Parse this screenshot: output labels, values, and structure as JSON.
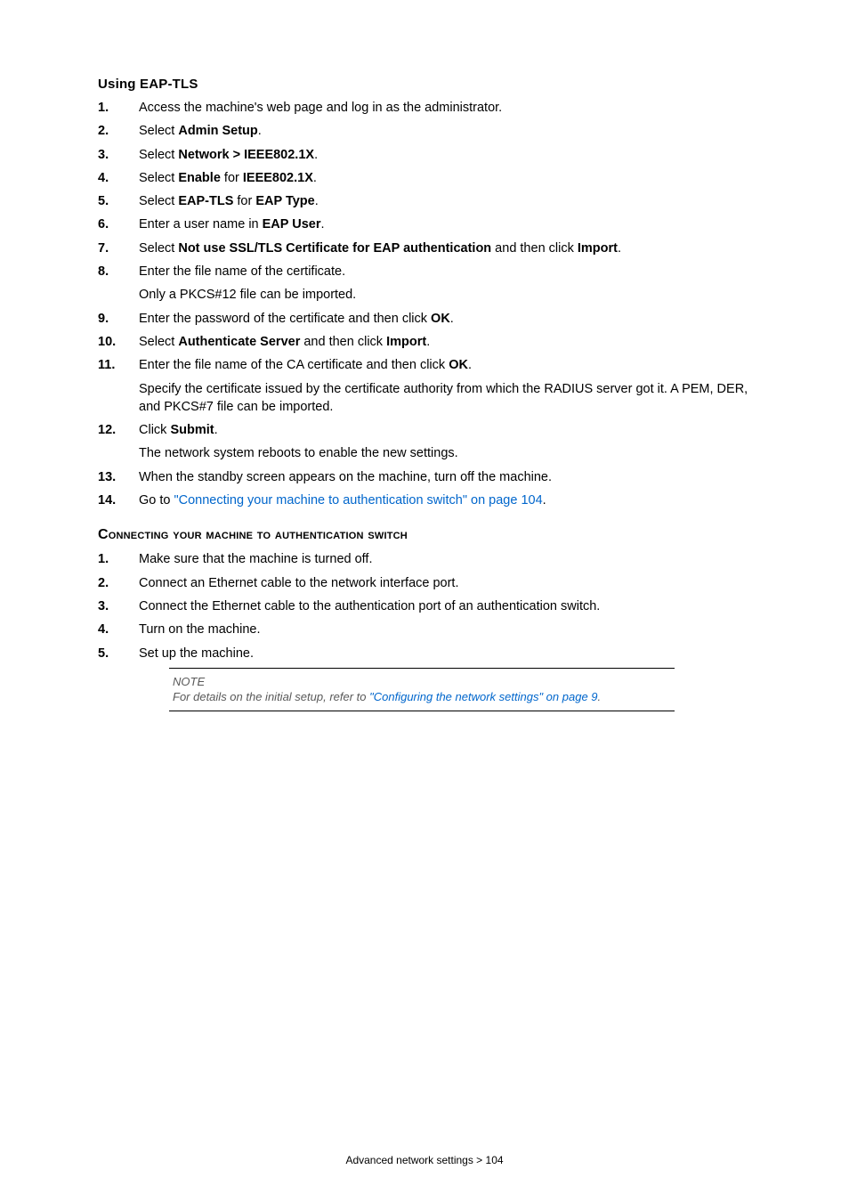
{
  "h1": "Using EAP-TLS",
  "steps1": [
    {
      "n": "1.",
      "html": "Access the machine's web page and log in as the administrator."
    },
    {
      "n": "2.",
      "html": "Select <b>Admin Setup</b>."
    },
    {
      "n": "3.",
      "html": "Select <b>Network > IEEE802.1X</b>."
    },
    {
      "n": "4.",
      "html": "Select <b>Enable</b> for <b>IEEE802.1X</b>."
    },
    {
      "n": "5.",
      "html": "Select <b>EAP-TLS</b> for <b>EAP Type</b>."
    },
    {
      "n": "6.",
      "html": "Enter a user name in <b>EAP User</b>."
    },
    {
      "n": "7.",
      "html": "Select <b>Not use SSL/TLS Certificate for EAP authentication</b> and then click <b>Import</b>."
    },
    {
      "n": "8.",
      "html": "Enter the file name of the certificate."
    }
  ],
  "indent8": "Only a PKCS#12 file can be imported.",
  "steps1b": [
    {
      "n": "9.",
      "html": "Enter the password of the certificate and then click <b>OK</b>."
    },
    {
      "n": "10.",
      "html": "Select <b>Authenticate Server</b> and then click <b>Import</b>."
    },
    {
      "n": "11.",
      "html": "Enter the file name of the CA certificate and then click <b>OK</b>."
    }
  ],
  "indent11": "Specify the certificate issued by the certificate authority from which the RADIUS server got it. A PEM, DER, and PKCS#7 file can be imported.",
  "steps1c": [
    {
      "n": "12.",
      "html": "Click <b>Submit</b>."
    }
  ],
  "indent12": "The network system reboots to enable the new settings.",
  "steps1d": [
    {
      "n": "13.",
      "html": "When the standby screen appears on the machine, turn off the machine."
    },
    {
      "n": "14.",
      "html": "Go to <span class=\"link\">\"Connecting your machine to authentication switch\" on page 104</span>."
    }
  ],
  "h2": "Connecting your machine to authentication switch",
  "steps2": [
    {
      "n": "1.",
      "html": "Make sure that the machine is turned off."
    },
    {
      "n": "2.",
      "html": "Connect an Ethernet cable to the network interface port."
    },
    {
      "n": "3.",
      "html": "Connect the Ethernet cable to the authentication port of an authentication switch."
    },
    {
      "n": "4.",
      "html": "Turn on the machine."
    },
    {
      "n": "5.",
      "html": "Set up the machine."
    }
  ],
  "note_title": "NOTE",
  "note_body_pre": "For details on the initial setup, refer to ",
  "note_link": "\"Configuring the network settings\" on page 9",
  "note_body_post": ".",
  "footer": "Advanced network settings > 104"
}
